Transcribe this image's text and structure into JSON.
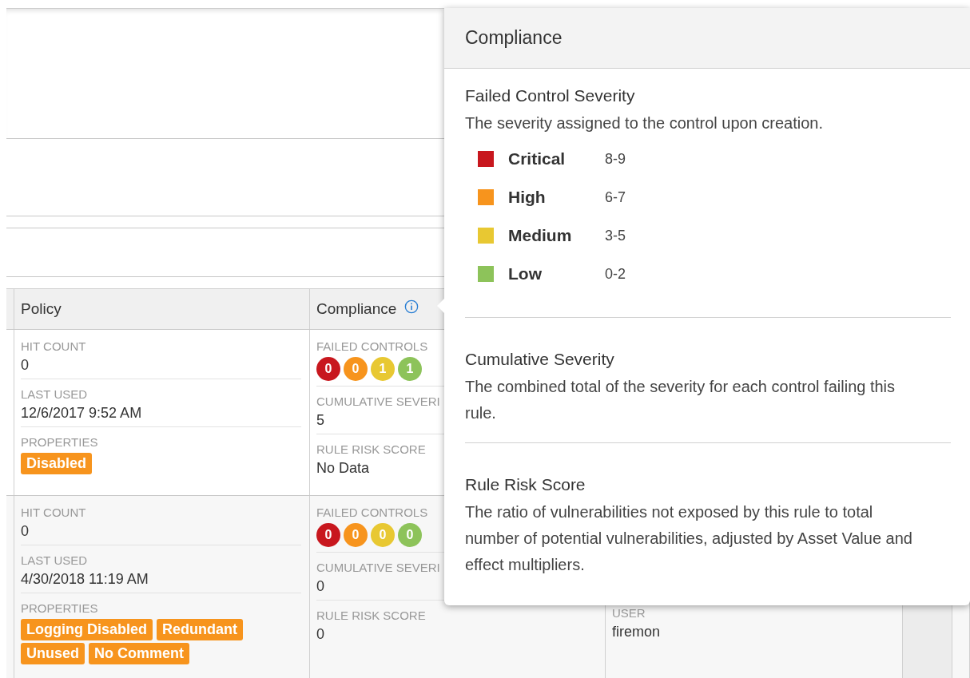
{
  "table": {
    "columns": [
      "Policy",
      "Compliance"
    ],
    "rows": [
      {
        "policy": {
          "fields": [
            {
              "label": "HIT COUNT",
              "value": "0"
            },
            {
              "label": "LAST USED",
              "value": "12/6/2017 9:52 AM"
            }
          ],
          "properties_label": "PROPERTIES",
          "tags": [
            "Disabled"
          ]
        },
        "compliance": {
          "failed_controls_label": "FAILED CONTROLS",
          "failed_controls": [
            {
              "value": "0",
              "color": "#c8171e"
            },
            {
              "value": "0",
              "color": "#f7941d"
            },
            {
              "value": "1",
              "color": "#e8c832"
            },
            {
              "value": "1",
              "color": "#8dc35a"
            }
          ],
          "fields": [
            {
              "label": "CUMULATIVE SEVERI",
              "value": "5"
            },
            {
              "label": "RULE RISK SCORE",
              "value": "No Data"
            }
          ]
        }
      },
      {
        "policy": {
          "fields": [
            {
              "label": "HIT COUNT",
              "value": "0"
            },
            {
              "label": "LAST USED",
              "value": "4/30/2018 11:19 AM"
            }
          ],
          "properties_label": "PROPERTIES",
          "tags": [
            "Logging Disabled",
            "Redundant",
            "Unused",
            "No Comment"
          ]
        },
        "compliance": {
          "failed_controls_label": "FAILED CONTROLS",
          "failed_controls": [
            {
              "value": "0",
              "color": "#c8171e"
            },
            {
              "value": "0",
              "color": "#f7941d"
            },
            {
              "value": "0",
              "color": "#e8c832"
            },
            {
              "value": "0",
              "color": "#8dc35a"
            }
          ],
          "fields": [
            {
              "label": "CUMULATIVE SEVERI",
              "value": "0"
            },
            {
              "label": "RULE RISK SCORE",
              "value": "0"
            }
          ]
        },
        "column_3": {
          "fields": [
            {
              "label": "USER",
              "value": "firemon"
            }
          ]
        }
      }
    ]
  },
  "popover": {
    "title": "Compliance",
    "sections": [
      {
        "heading": "Failed Control Severity",
        "text": "The severity assigned to the control upon creation.",
        "legend": [
          {
            "label": "Critical",
            "range": "8-9",
            "color": "#c8171e"
          },
          {
            "label": "High",
            "range": "6-7",
            "color": "#f7941d"
          },
          {
            "label": "Medium",
            "range": "3-5",
            "color": "#e8c832"
          },
          {
            "label": "Low",
            "range": "0-2",
            "color": "#8dc35a"
          }
        ]
      },
      {
        "heading": "Cumulative Severity",
        "text": "The combined total of the severity for each control failing this rule."
      },
      {
        "heading": "Rule Risk Score",
        "text": "The ratio of vulnerabilities not exposed by this rule to total number of potential vulnerabilities, adjusted by Asset Value and effect multipliers."
      }
    ]
  }
}
